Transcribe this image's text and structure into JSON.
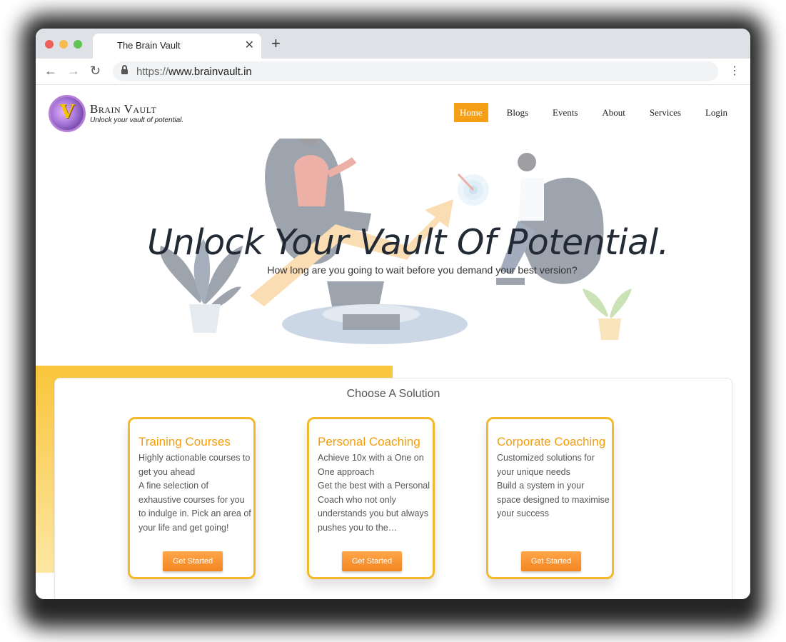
{
  "browser": {
    "tab_title": "The Brain Vault",
    "close_tab": "✕",
    "new_tab": "+",
    "url_scheme": "https://",
    "url_host": "www.brainvault.in"
  },
  "site": {
    "logo_letter": "V",
    "brand_name": "Brain Vault",
    "tagline": "Unlock your vault of potential."
  },
  "nav": [
    {
      "label": "Home",
      "active": true
    },
    {
      "label": "Blogs"
    },
    {
      "label": "Events"
    },
    {
      "label": "About"
    },
    {
      "label": "Services"
    },
    {
      "label": "Login"
    }
  ],
  "hero": {
    "title": "Unlock Your Vault Of Potential.",
    "subtitle": "How long are you going to wait before you demand your best version?"
  },
  "solutions": {
    "heading": "Choose A Solution",
    "cards": [
      {
        "title": "Training Courses",
        "body": "Highly actionable courses to get you ahead\nA fine selection of exhaustive courses for you to indulge in. Pick an area of your life and get going!",
        "button": "Get Started"
      },
      {
        "title": "Personal Coaching",
        "body": "Achieve 10x with a One on One approach\nGet the best with a Personal Coach who not only understands you but always pushes you to the…",
        "button": "Get Started"
      },
      {
        "title": "Corporate Coaching",
        "body": "Customized solutions for your unique needs\nBuild a system in your space designed to maximise your success",
        "button": "Get Started"
      }
    ]
  },
  "colors": {
    "accent": "#f59f16",
    "card_border": "#f4b92b",
    "band": "#f9c53b"
  }
}
